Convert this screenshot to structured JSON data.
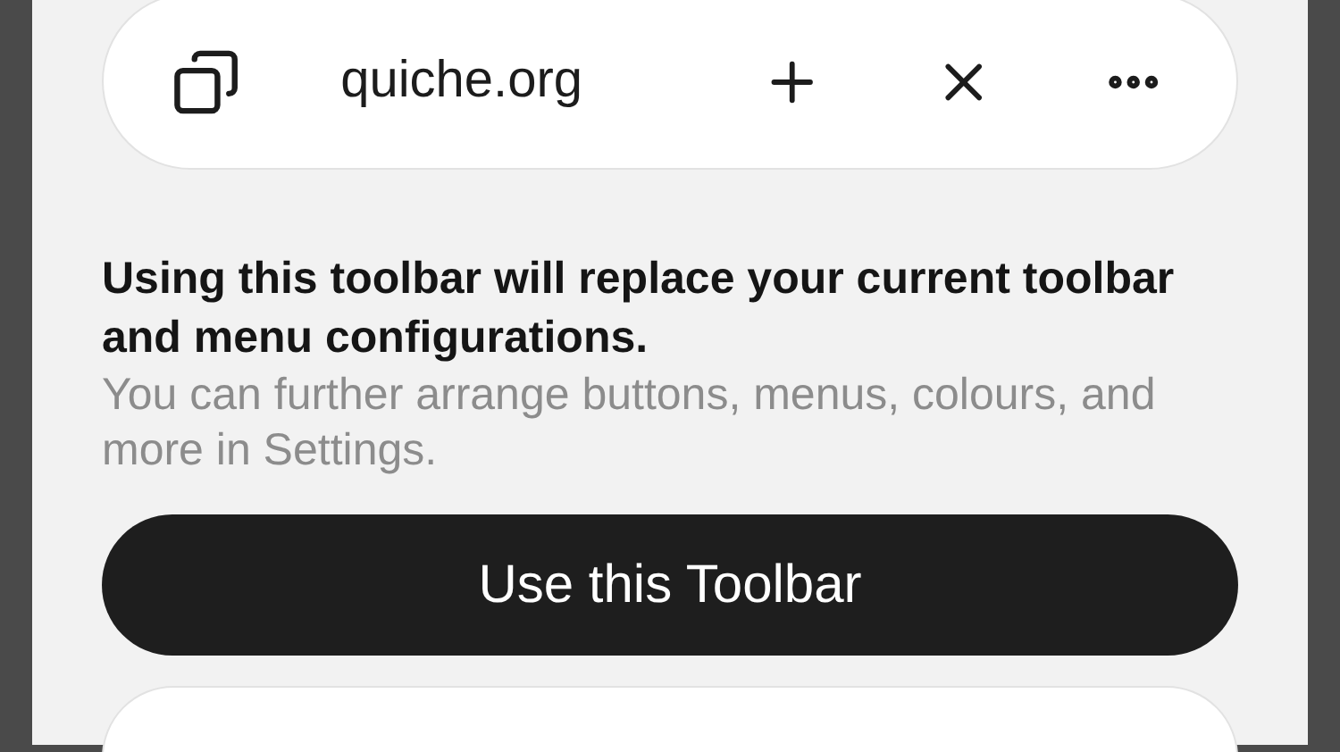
{
  "address_bar": {
    "url": "quiche.org"
  },
  "message": {
    "title": "Using this toolbar will replace your current toolbar and menu configurations.",
    "body": "You can further arrange buttons, menus, colours, and more in Settings."
  },
  "primary_button": {
    "label": "Use this Toolbar"
  }
}
